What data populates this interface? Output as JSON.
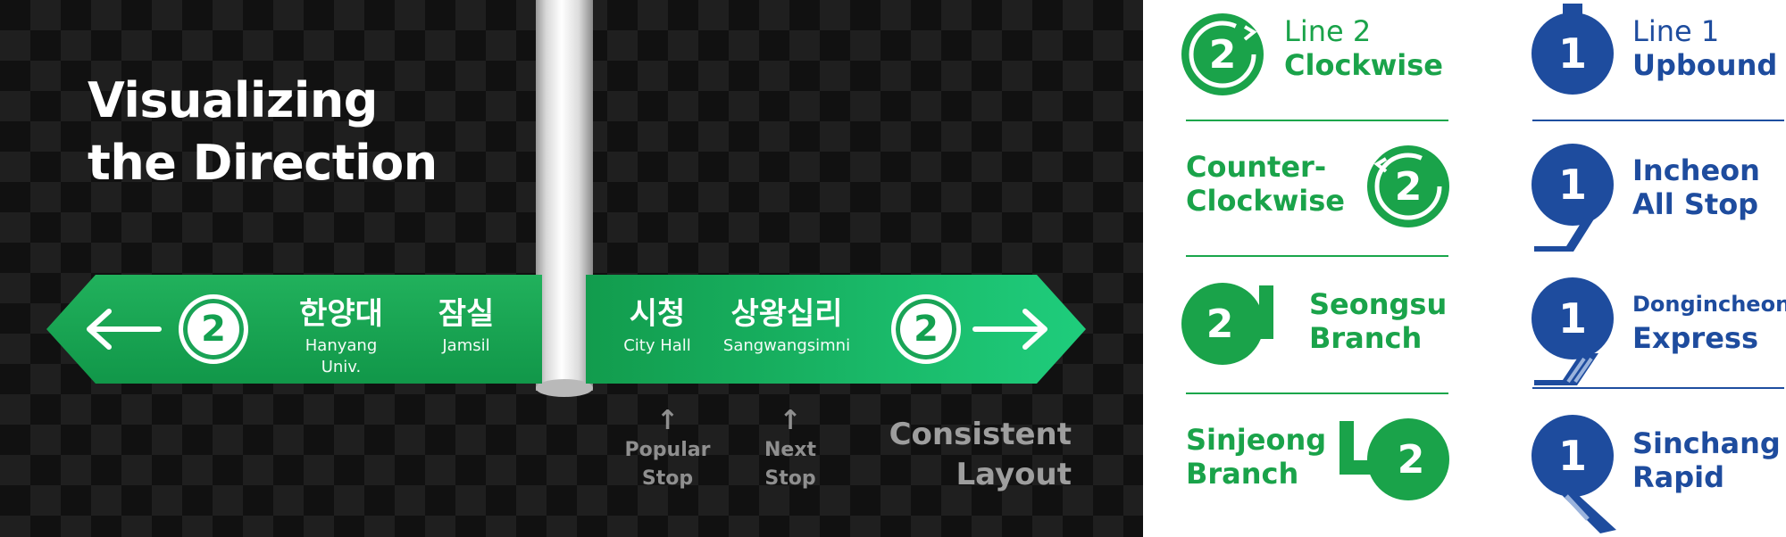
{
  "heading": {
    "line1": "Visualizing",
    "line2": "the Direction"
  },
  "sign_left": {
    "line_number": "2",
    "stations": [
      {
        "ko": "한양대",
        "en": "Hanyang Univ."
      },
      {
        "ko": "잠실",
        "en": "Jamsil"
      }
    ]
  },
  "sign_right": {
    "line_number": "2",
    "stations": [
      {
        "ko": "시청",
        "en": "City Hall"
      },
      {
        "ko": "상왕십리",
        "en": "Sangwangsimni"
      }
    ]
  },
  "annotations": {
    "popular_stop": {
      "line1": "Popular",
      "line2": "Stop"
    },
    "next_stop": {
      "line1": "Next",
      "line2": "Stop"
    },
    "consistent": {
      "line1": "Consistent",
      "line2": "Layout"
    }
  },
  "line2_signs": [
    {
      "number": "2",
      "line1": "Line 2",
      "line2": "Clockwise"
    },
    {
      "number": "2",
      "line1": "Counter-",
      "line2": "Clockwise"
    },
    {
      "number": "2",
      "line1": "Seongsu",
      "line2": "Branch"
    },
    {
      "number": "2",
      "line1": "Sinjeong",
      "line2": "Branch"
    }
  ],
  "line1_signs": [
    {
      "number": "1",
      "line1": "Line 1",
      "line2": "Upbound"
    },
    {
      "number": "1",
      "line1": "Incheon",
      "line2": "All Stop"
    },
    {
      "number": "1",
      "line1": "Dongincheon",
      "line2": "Express"
    },
    {
      "number": "1",
      "line1": "Sinchang",
      "line2": "Rapid"
    }
  ],
  "colors": {
    "line2_green": "#1aa34a",
    "line1_blue": "#1e4c9e",
    "scene_bg": "#111111"
  }
}
